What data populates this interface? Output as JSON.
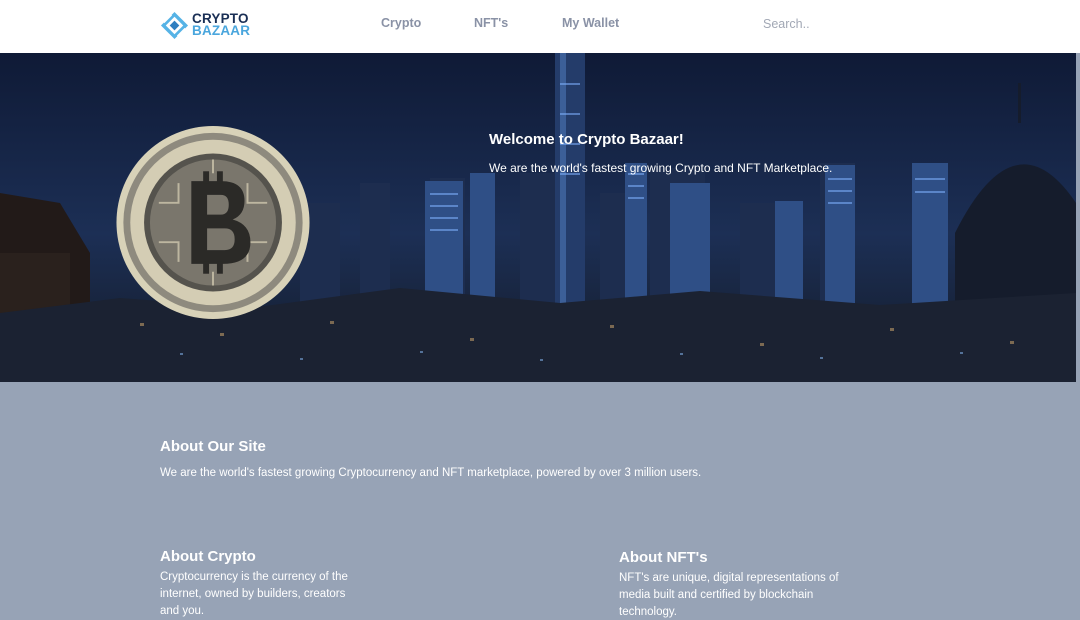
{
  "nav": {
    "logo_line1": "CRYPTO",
    "logo_line2": "BAZAAR",
    "links": [
      "Crypto",
      "NFT's",
      "My Wallet"
    ],
    "search_placeholder": "Search.."
  },
  "hero": {
    "title": "Welcome to Crypto Bazaar!",
    "subtitle": "We are the world's fastest growing Crypto and NFT Marketplace."
  },
  "about_site": {
    "title": "About Our Site",
    "text": "We are the world's fastest growing Cryptocurrency and NFT marketplace, powered by over 3 million users."
  },
  "about_crypto": {
    "title": "About Crypto",
    "text": "Cryptocurrency is the currency of the internet, owned by builders, creators and you."
  },
  "about_nft": {
    "title": "About NFT's",
    "text": "NFT's are unique, digital representations of media built and certified by blockchain technology."
  },
  "colors": {
    "page_bg": "#97a3b6",
    "nav_text": "#8a92a6",
    "logo_dark": "#1a2f55",
    "logo_light": "#4aa6dd"
  }
}
